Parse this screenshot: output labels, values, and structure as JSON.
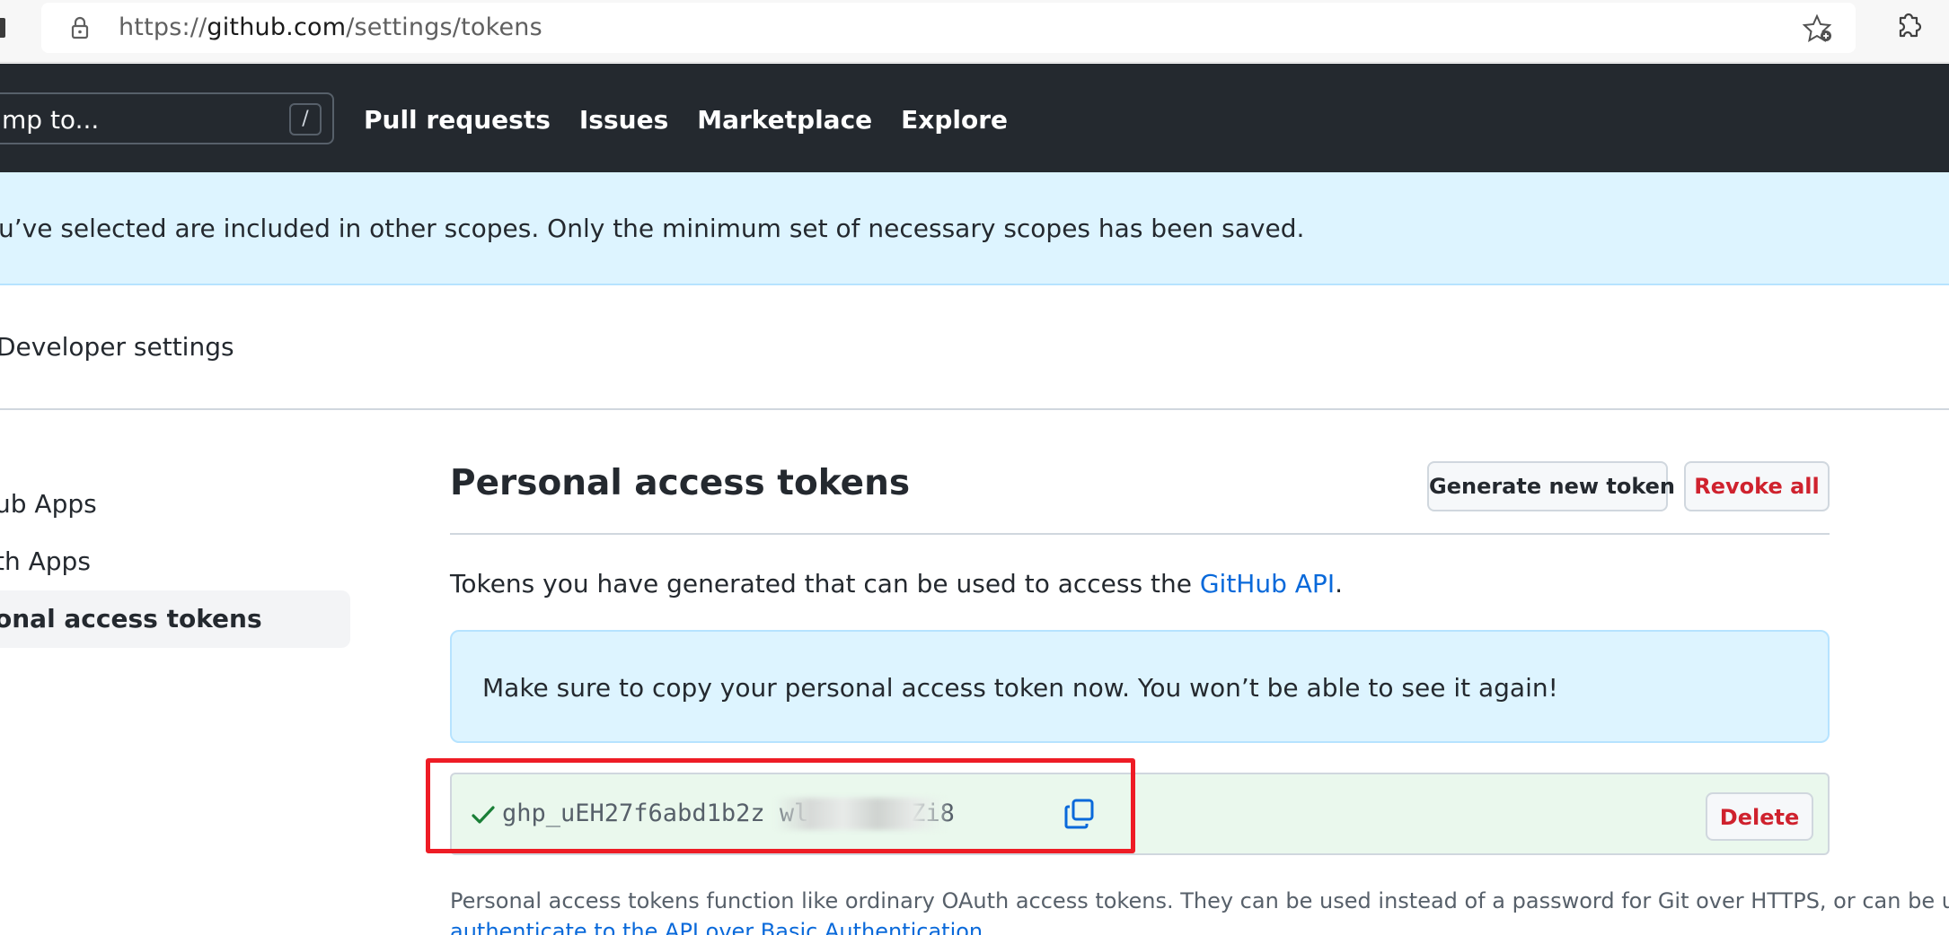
{
  "browser": {
    "url_prefix": "https://",
    "url_host": "github.com",
    "url_path": "/settings/tokens"
  },
  "header": {
    "search_placeholder": "mp to...",
    "search_shortcut": "/",
    "nav": [
      "Pull requests",
      "Issues",
      "Marketplace",
      "Explore"
    ]
  },
  "flash": {
    "message": "u’ve selected are included in other scopes. Only the minimum set of necessary scopes has been saved."
  },
  "breadcrumb": {
    "label": "Developer settings"
  },
  "sidebar": {
    "items": [
      {
        "label": "ub Apps"
      },
      {
        "label": "th Apps"
      },
      {
        "label": "onal access tokens"
      }
    ]
  },
  "main": {
    "title": "Personal access tokens",
    "generate_label": "Generate new token",
    "revoke_label": "Revoke all",
    "desc_prefix": "Tokens you have generated that can be used to access the ",
    "desc_link": "GitHub API",
    "desc_suffix": ".",
    "notice": "Make sure to copy your personal access token now. You won’t be able to see it again!",
    "token_visible": "ghp_uEH27f6abd1b2z                wlftHQ0TEZi8",
    "delete_label": "Delete",
    "footnote": "Personal access tokens function like ordinary OAuth access tokens. They can be used instead of a password for Git over HTTPS, or can be used to",
    "footnote_link": "authenticate to the API over Basic Authentication"
  },
  "colors": {
    "header_bg": "#24292f",
    "flash_bg": "#ddf4ff",
    "token_bg": "#eaf8ed",
    "danger": "#cf222e",
    "link": "#0969da",
    "annotation": "#ee1c25"
  }
}
